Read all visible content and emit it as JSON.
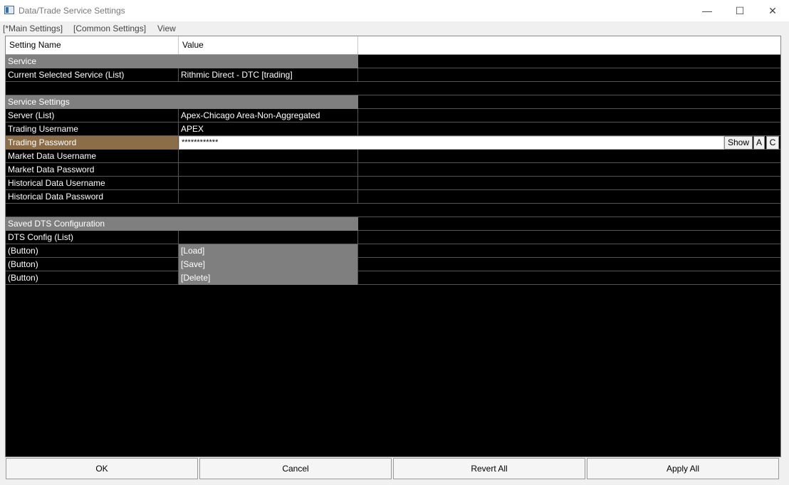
{
  "window": {
    "title": "Data/Trade Service Settings",
    "minimize": "—",
    "maximize": "☐",
    "close": "✕"
  },
  "menu": [
    "[*Main Settings]",
    "[Common Settings]",
    "View"
  ],
  "columns": [
    "Setting Name",
    "Value"
  ],
  "rows": [
    {
      "type": "group",
      "name": "Service"
    },
    {
      "type": "item",
      "name": "Current Selected Service (List)",
      "value": "Rithmic Direct - DTC    [trading]"
    },
    {
      "type": "blank"
    },
    {
      "type": "group",
      "name": "Service Settings"
    },
    {
      "type": "item",
      "name": "Server (List)",
      "value": "Apex-Chicago Area-Non-Aggregated"
    },
    {
      "type": "item",
      "name": "Trading Username",
      "value": "APEX"
    },
    {
      "type": "password",
      "name": "Trading Password",
      "value": "************",
      "show": "Show",
      "a": "A",
      "c": "C"
    },
    {
      "type": "item",
      "name": "Market Data Username",
      "value": ""
    },
    {
      "type": "item",
      "name": "Market Data Password",
      "value": ""
    },
    {
      "type": "item",
      "name": "Historical Data Username",
      "value": ""
    },
    {
      "type": "item",
      "name": "Historical Data Password",
      "value": ""
    },
    {
      "type": "blank"
    },
    {
      "type": "group",
      "name": "Saved DTS Configuration"
    },
    {
      "type": "item",
      "name": "DTS Config (List)",
      "value": ""
    },
    {
      "type": "button",
      "name": " (Button)",
      "value": "[Load]"
    },
    {
      "type": "button",
      "name": " (Button)",
      "value": "[Save]"
    },
    {
      "type": "button",
      "name": " (Button)",
      "value": "[Delete]"
    }
  ],
  "footer": {
    "ok": "OK",
    "cancel": "Cancel",
    "revert": "Revert All",
    "apply": "Apply All"
  }
}
